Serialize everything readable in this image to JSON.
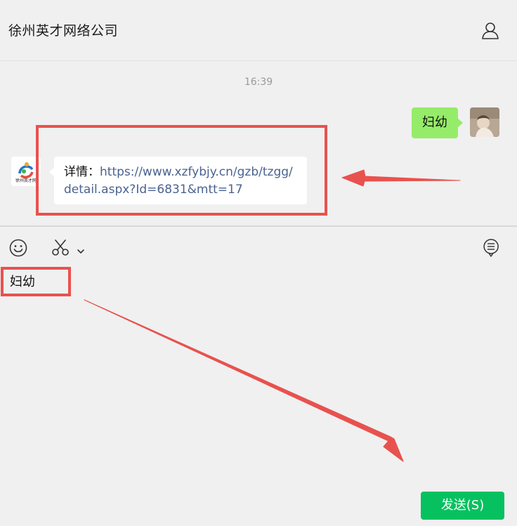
{
  "header": {
    "title": "徐州英才网络公司",
    "profile_icon": "person-icon"
  },
  "chat": {
    "timestamp": "16:39",
    "messages": [
      {
        "side": "right",
        "text": "妇幼"
      },
      {
        "side": "left",
        "prefix": "详情：",
        "link": "https://www.xzfybjy.cn/gzb/tzgg/detail.aspx?Id=6831&mtt=17"
      }
    ],
    "company_logo_text": "徐州英才网"
  },
  "toolbar": {
    "emoji_icon": "smiley-icon",
    "screenshot_icon": "scissors-icon",
    "dropdown_icon": "chevron-down-icon",
    "history_icon": "chat-history-icon"
  },
  "input": {
    "value": "妇幼"
  },
  "send_button": {
    "label": "发送(S)"
  },
  "colors": {
    "accent_green": "#07c160",
    "bubble_green": "#95ec69",
    "annotation_red": "#e8524e",
    "link": "#4a6390"
  }
}
